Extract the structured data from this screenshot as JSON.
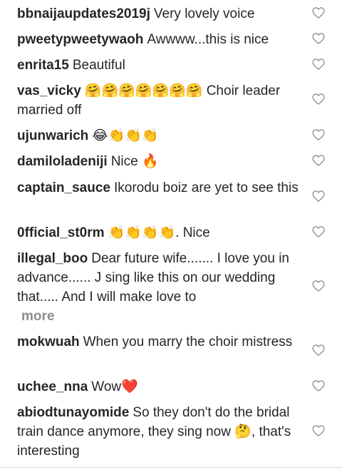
{
  "comments": [
    {
      "username": "bbnaijaupdates2019j",
      "text": "Very lovely voice",
      "more": ""
    },
    {
      "username": "pweetypweetywaoh",
      "text": "Awwww...this is nice",
      "more": ""
    },
    {
      "username": "enrita15",
      "text": "Beautiful",
      "more": ""
    },
    {
      "username": "vas_vicky",
      "text": "🤗🤗🤗🤗🤗🤗🤗 Choir leader married off",
      "more": ""
    },
    {
      "username": "ujunwarich",
      "text": "😂👏👏👏",
      "more": ""
    },
    {
      "username": "damiloladeniji",
      "text": "Nice 🔥",
      "more": ""
    },
    {
      "username": "captain_sauce",
      "text": "Ikorodu boiz are yet to see this",
      "more": ""
    },
    {
      "username": "0fficial_st0rm",
      "text": "👏👏👏👏. Nice",
      "more": ""
    },
    {
      "username": "illegal_boo",
      "text": "Dear future wife....... I love you in advance...... J sing like this on our wedding that..... And I will make love to",
      "more": "more"
    },
    {
      "username": "mokwuah",
      "text": "When you marry the choir mistress",
      "more": ""
    },
    {
      "username": "uchee_nna",
      "text": "Wow❤️",
      "more": ""
    },
    {
      "username": "abiodtunayomide",
      "text": "So they don't do the bridal train dance anymore, they sing now 🤔, that's interesting",
      "more": ""
    }
  ],
  "icons": {
    "like": "heart-outline-icon",
    "like_color": "#8e8e8e"
  },
  "colors": {
    "username": "#262626",
    "text": "#262626",
    "more": "#8e8e8e"
  }
}
